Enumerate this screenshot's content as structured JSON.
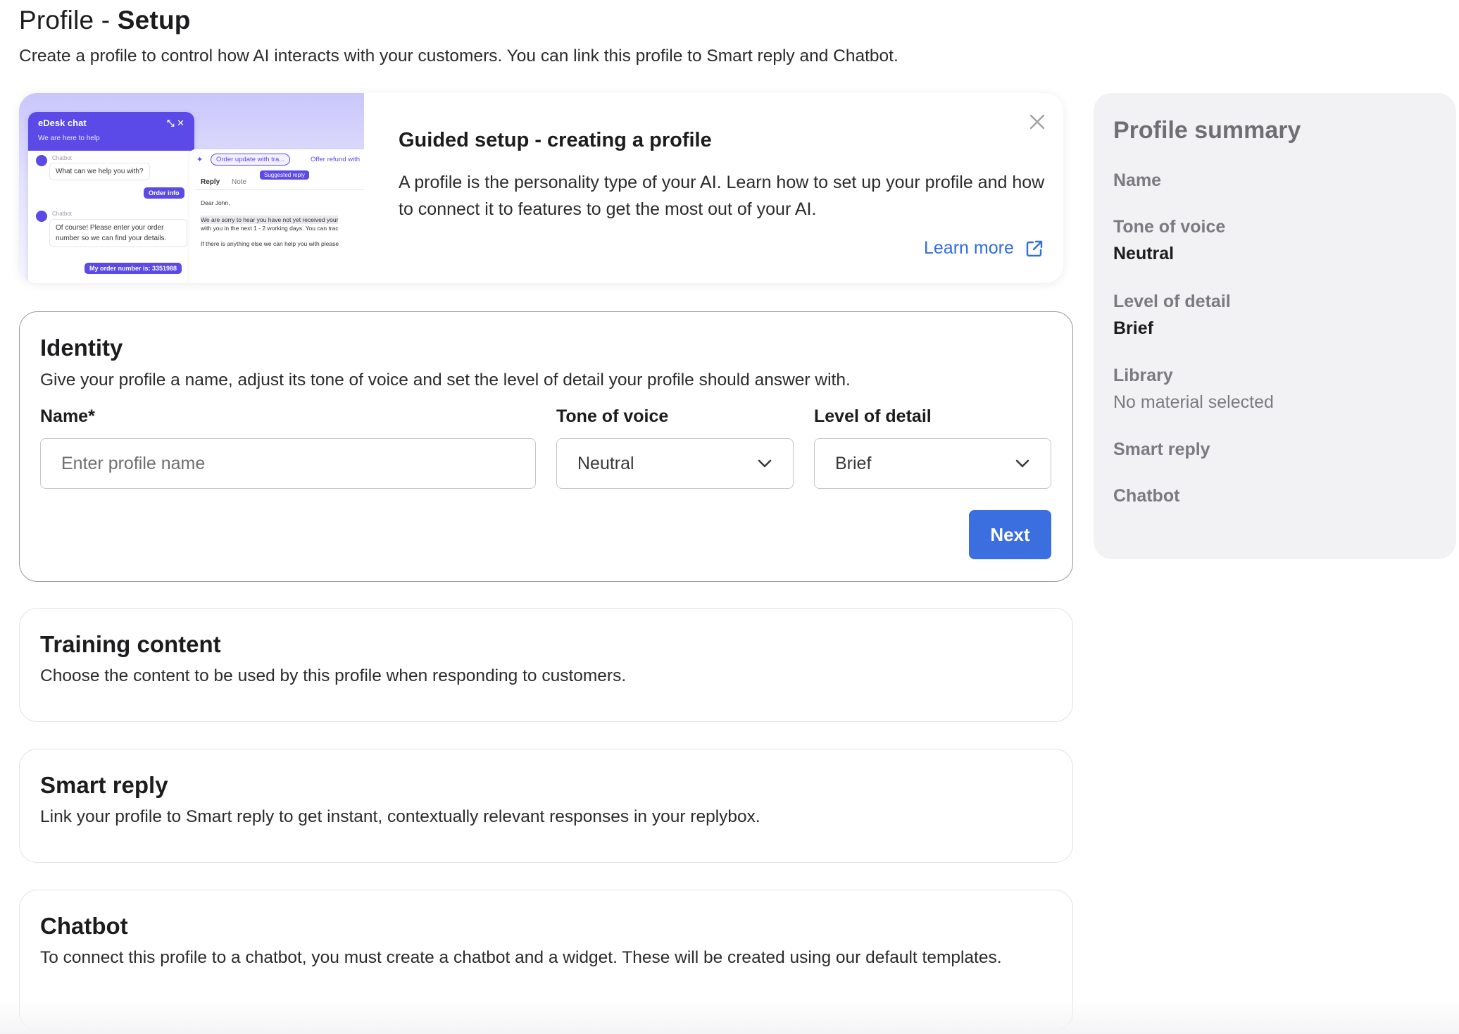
{
  "header": {
    "title_prefix": "Profile - ",
    "title_bold": "Setup",
    "subtitle": "Create a profile to control how AI interacts with your customers. You can link this profile to Smart reply and Chatbot."
  },
  "guide": {
    "title": "Guided setup - creating a profile",
    "text": "A profile is the personality type of your AI. Learn how to set up your profile and how to connect it to features to get the most out of your AI.",
    "learn_more": "Learn more",
    "illustration": {
      "chat_title": "eDesk chat",
      "chat_sub": "We are here to help",
      "bot_label": "Chatbot",
      "bot_msg1": "What can we help you with?",
      "user_pill1": "Order info",
      "bot_msg2_line1": "Of course! Please enter your order",
      "bot_msg2_line2": "number so we can find your details.",
      "user_pill2": "My order number is: 3351988",
      "chip1": "Order update with tra...",
      "chip2": "Offer refund with",
      "suggested": "Suggested reply",
      "tab_reply": "Reply",
      "tab_note": "Note",
      "greeting": "Dear John,",
      "body1": "We are sorry to hear you have not yet received your",
      "body2": "with you in the next 1 - 2 working days. You can trac",
      "body3": "If there is anything else we can help you with please"
    }
  },
  "identity": {
    "title": "Identity",
    "description": "Give your profile a name, adjust its tone of voice and set the level of detail your profile should answer with.",
    "name_label": "Name",
    "required_mark": "*",
    "name_placeholder": "Enter profile name",
    "tone_label": "Tone of voice",
    "tone_value": "Neutral",
    "detail_label": "Level of detail",
    "detail_value": "Brief",
    "next": "Next"
  },
  "training": {
    "title": "Training content",
    "description": "Choose the content to be used by this profile when responding to customers."
  },
  "smart_reply": {
    "title": "Smart reply",
    "description": "Link your profile to Smart reply to get instant, contextually relevant responses in your replybox."
  },
  "chatbot": {
    "title": "Chatbot",
    "description": "To connect this profile to a chatbot, you must create a chatbot and a widget. These will be created using our default templates."
  },
  "summary": {
    "title": "Profile summary",
    "name_label": "Name",
    "tone_label": "Tone of voice",
    "tone_value": "Neutral",
    "detail_label": "Level of detail",
    "detail_value": "Brief",
    "library_label": "Library",
    "library_value": "No material selected",
    "smart_reply_label": "Smart reply",
    "chatbot_label": "Chatbot"
  },
  "colors": {
    "accent": "#3b6fe0",
    "link": "#2f6ce5",
    "brand_purple": "#5b49e8"
  }
}
